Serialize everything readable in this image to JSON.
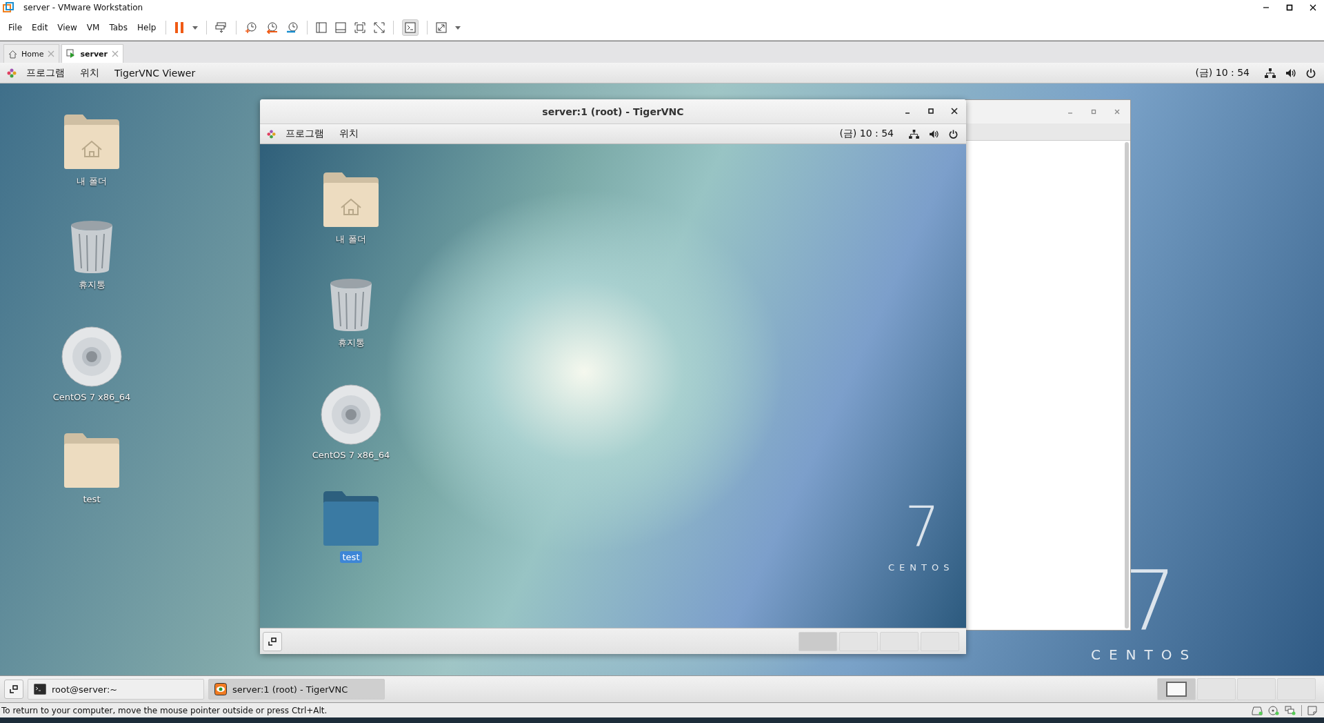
{
  "window": {
    "title": "server - VMware Workstation"
  },
  "menu": [
    "File",
    "Edit",
    "View",
    "VM",
    "Tabs",
    "Help"
  ],
  "tabs": [
    {
      "label": "Home",
      "selected": false
    },
    {
      "label": "server",
      "selected": true
    }
  ],
  "guest": {
    "top_bar": {
      "menus": [
        "프로그램",
        "위치"
      ],
      "app_name": "TigerVNC Viewer",
      "clock": "(금) 10 : 54"
    },
    "desktop_icons": [
      {
        "kind": "home-folder",
        "label": "내 폴더",
        "selected": false
      },
      {
        "kind": "trash",
        "label": "휴지통",
        "selected": false
      },
      {
        "kind": "disc",
        "label": "CentOS 7 x86_64",
        "selected": false
      },
      {
        "kind": "folder",
        "label": "test",
        "selected": false
      }
    ],
    "wallpaper": {
      "number": "7",
      "brand": "CENTOS"
    },
    "vnc_window": {
      "title": "server:1 (root) - TigerVNC",
      "top_bar": {
        "menus": [
          "프로그램",
          "위치"
        ],
        "clock": "(금) 10 : 54"
      },
      "desktop_icons": [
        {
          "kind": "home-folder",
          "label": "내 폴더",
          "selected": false
        },
        {
          "kind": "trash",
          "label": "휴지통",
          "selected": false
        },
        {
          "kind": "disc",
          "label": "CentOS 7 x86_64",
          "selected": false
        },
        {
          "kind": "folder",
          "label": "test",
          "selected": true
        }
      ],
      "wallpaper": {
        "number": "7",
        "brand": "CENTOS"
      },
      "workspaces": [
        {
          "selected": true
        },
        {
          "selected": false
        },
        {
          "selected": false
        },
        {
          "selected": false
        }
      ]
    },
    "taskbar": {
      "items": [
        {
          "kind": "terminal",
          "label": "root@server:~",
          "selected": false
        },
        {
          "kind": "vnc",
          "label": "server:1 (root) - TigerVNC",
          "selected": true
        }
      ],
      "workspaces": [
        {
          "selected": true
        },
        {
          "selected": false
        },
        {
          "selected": false
        },
        {
          "selected": false
        }
      ]
    }
  },
  "status_bar": {
    "message": "To return to your computer, move the mouse pointer outside or press Ctrl+Alt."
  }
}
